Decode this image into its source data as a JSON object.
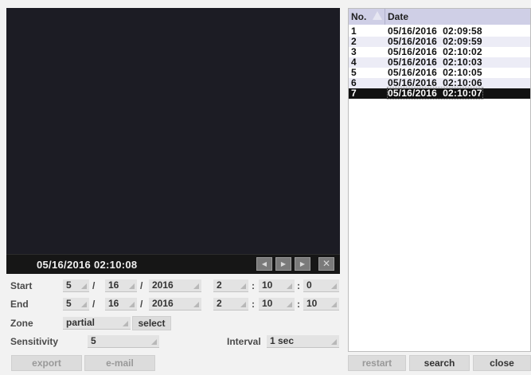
{
  "player": {
    "timestamp": "05/16/2016 02:10:08",
    "controls": [
      "prev-icon",
      "play-icon",
      "next-icon",
      "close-icon"
    ]
  },
  "labels": {
    "start": "Start",
    "end": "End",
    "zone": "Zone",
    "sensitivity": "Sensitivity",
    "interval": "Interval"
  },
  "start": {
    "month": "5",
    "day": "16",
    "year": "2016",
    "hour": "2",
    "minute": "10",
    "second": "0"
  },
  "end": {
    "month": "5",
    "day": "16",
    "year": "2016",
    "hour": "2",
    "minute": "10",
    "second": "10"
  },
  "separators": {
    "date": "/",
    "time": ":"
  },
  "zone_value": "partial",
  "sensitivity_value": "5",
  "interval_value": "1 sec",
  "buttons": {
    "select": "select",
    "export": "export",
    "email": "e-mail",
    "restart": "restart",
    "search": "search",
    "close": "close"
  },
  "table": {
    "headers": {
      "no": "No.",
      "date": "Date"
    },
    "rows": [
      {
        "no": "1",
        "date": "05/16/2016  02:09:58"
      },
      {
        "no": "2",
        "date": "05/16/2016  02:09:59"
      },
      {
        "no": "3",
        "date": "05/16/2016  02:10:02"
      },
      {
        "no": "4",
        "date": "05/16/2016  02:10:03"
      },
      {
        "no": "5",
        "date": "05/16/2016  02:10:05"
      },
      {
        "no": "6",
        "date": "05/16/2016  02:10:06"
      },
      {
        "no": "7",
        "date": "05/16/2016  02:10:07"
      }
    ],
    "selected_row": "7"
  },
  "colors": {
    "video_bg": "#1c1c24",
    "header_bg": "#cfcfe6",
    "selected_row_bg": "#111111"
  }
}
